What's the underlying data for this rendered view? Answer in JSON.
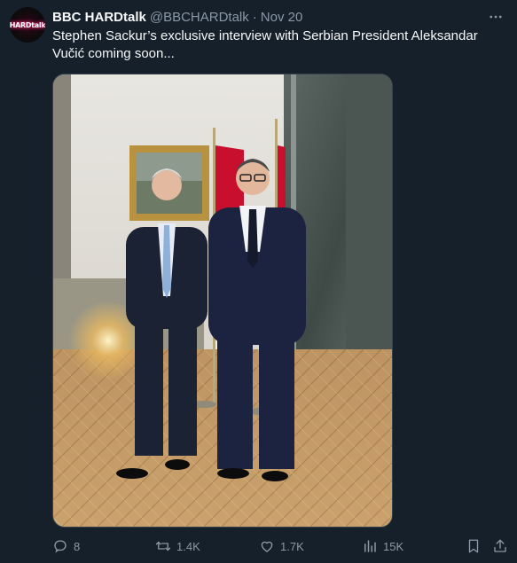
{
  "tweet": {
    "avatar_text": "HARDtalk",
    "display_name": "BBC HARDtalk",
    "handle": "@BBCHARDtalk",
    "separator": "·",
    "date": "Nov 20",
    "text": "Stephen Sackur’s exclusive interview with Serbian President  Aleksandar Vučić coming soon..."
  },
  "icons": {
    "more": "more-dots-icon",
    "reply": "reply-icon",
    "retweet": "retweet-icon",
    "like": "heart-icon",
    "views": "analytics-icon",
    "bookmark": "bookmark-icon",
    "share": "share-icon"
  },
  "stats": {
    "replies": "8",
    "retweets": "1.4K",
    "likes": "1.7K",
    "views": "15K"
  },
  "colors": {
    "background": "#15202b",
    "primary_text": "#f7f9f9",
    "secondary_text": "#8b98a5"
  }
}
